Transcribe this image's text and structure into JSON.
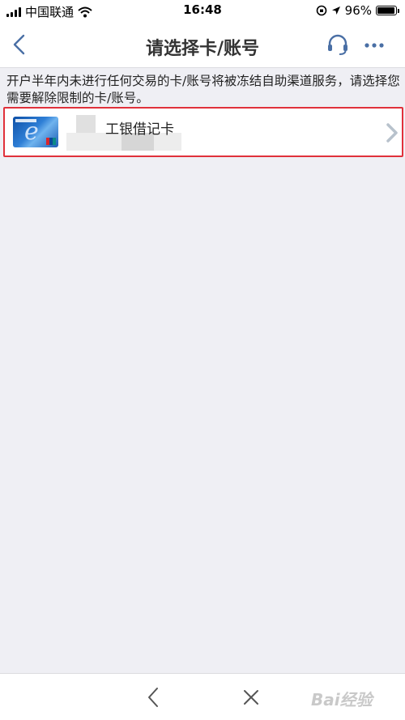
{
  "status_bar": {
    "carrier": "中国联通",
    "time": "16:48",
    "battery": "96%",
    "battery_level": 0.96
  },
  "nav": {
    "title": "请选择卡/账号",
    "icons": [
      "back-icon",
      "headset-icon",
      "more-icon"
    ]
  },
  "notice": {
    "text": "开户半年内未进行任何交易的卡/账号将被冻结自助渠道服务，请选择您需要解除限制的卡/账号。"
  },
  "card_list": [
    {
      "name": "工银借记卡",
      "icon": "bank-card-icon"
    }
  ],
  "bottom_bar": {
    "icons": [
      "back-icon",
      "close-icon"
    ],
    "watermark": "Bai经验"
  },
  "colors": {
    "highlight_border": "#e0313b",
    "nav_icon": "#4a6fa5",
    "background": "#efeff4"
  }
}
